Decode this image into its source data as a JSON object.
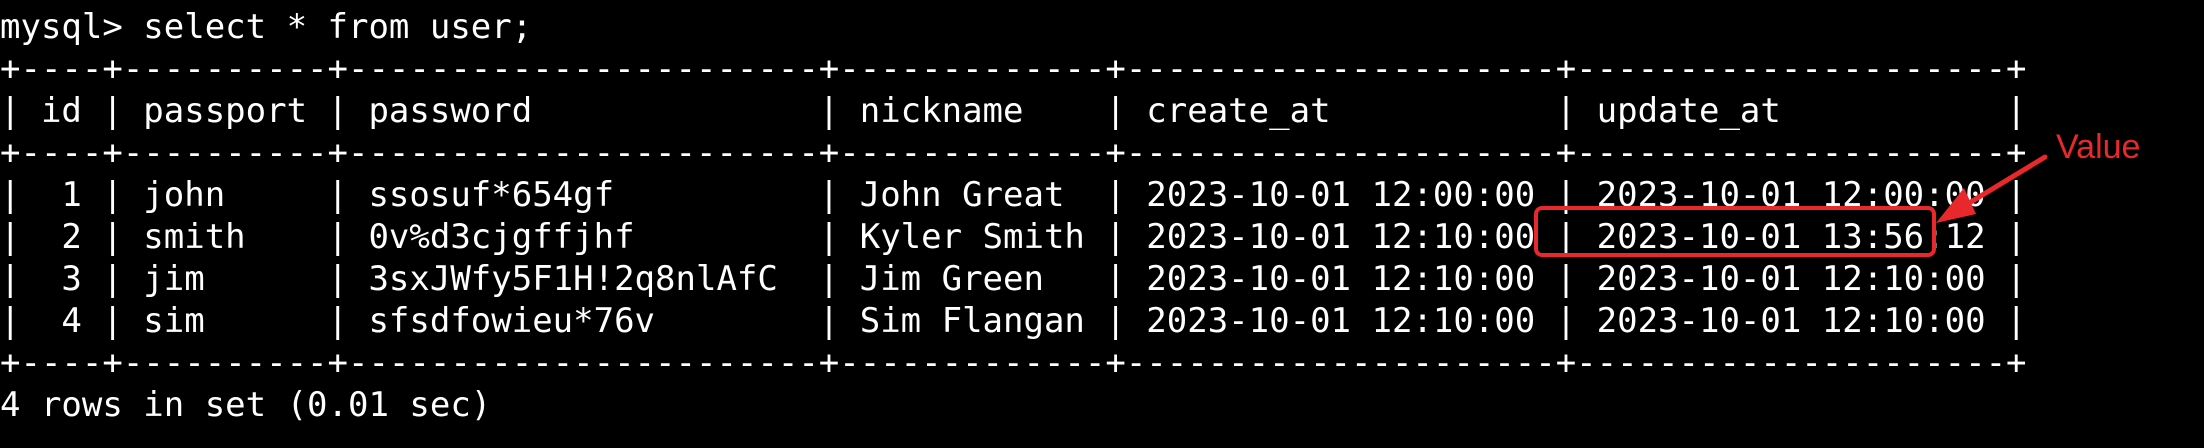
{
  "terminal": {
    "prompt_line": "mysql> select * from user;",
    "border": "+----+----------+-----------------------+-------------+---------------------+---------------------+",
    "header": "| id | passport | password              | nickname    | create_at           | update_at           |",
    "rows": [
      "|  1 | john     | ssosuf*654gf          | John Great  | 2023-10-01 12:00:00 | 2023-10-01 12:00:00 |",
      "|  2 | smith    | 0v%d3cjgffjhf         | Kyler Smith | 2023-10-01 12:10:00 | 2023-10-01 13:56:12 |",
      "|  3 | jim      | 3sxJWfy5F1H!2q8nlAfC  | Jim Green   | 2023-10-01 12:10:00 | 2023-10-01 12:10:00 |",
      "|  4 | sim      | sfsdfowieu*76v        | Sim Flangan | 2023-10-01 12:10:00 | 2023-10-01 12:10:00 |"
    ],
    "footer": "4 rows in set (0.01 sec)"
  },
  "annotation": {
    "label": "Value",
    "color": "#e8282b"
  }
}
